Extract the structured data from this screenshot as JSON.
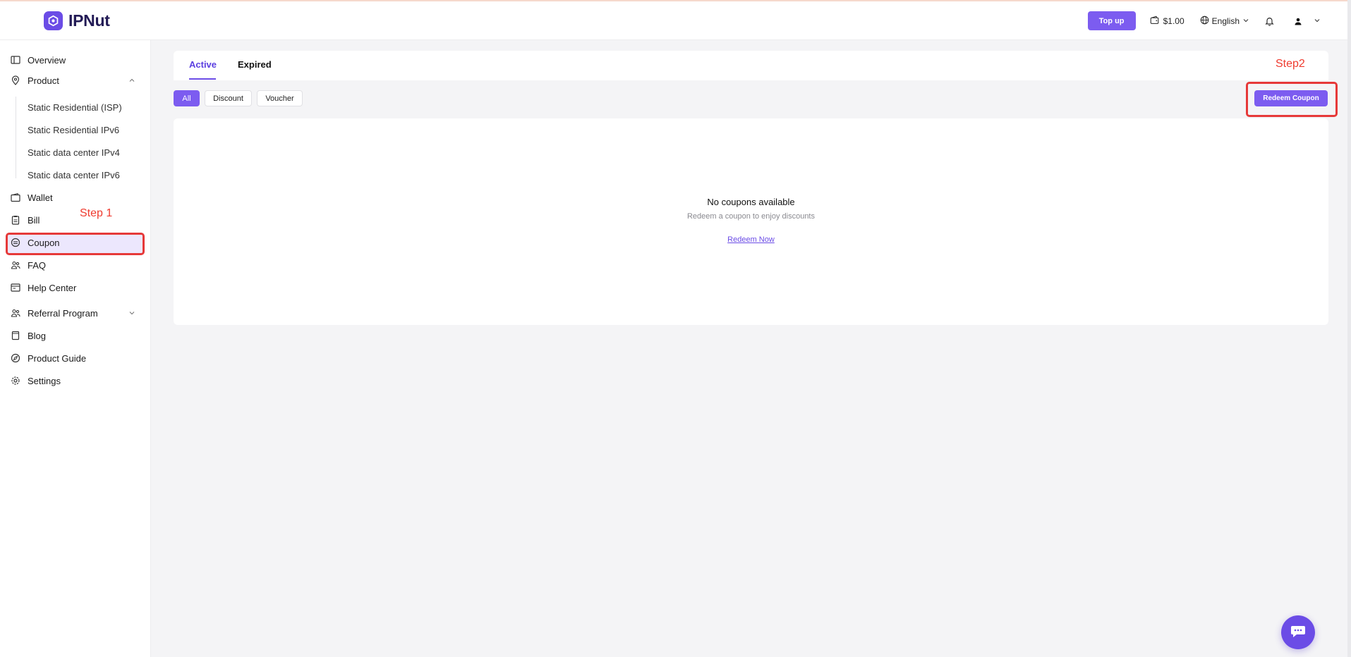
{
  "brand": {
    "name": "IPNut"
  },
  "header": {
    "topup_label": "Top up",
    "balance": "$1.00",
    "language": "English"
  },
  "sidebar": {
    "items": [
      {
        "label": "Overview",
        "icon": "panel-icon"
      },
      {
        "label": "Product",
        "icon": "location-pin-icon"
      },
      {
        "label": "Wallet",
        "icon": "wallet-icon"
      },
      {
        "label": "Bill",
        "icon": "clipboard-icon"
      },
      {
        "label": "Coupon",
        "icon": "coupon-icon"
      },
      {
        "label": "FAQ",
        "icon": "people-icon"
      },
      {
        "label": "Help Center",
        "icon": "browser-icon"
      },
      {
        "label": "Referral Program",
        "icon": "people-icon"
      },
      {
        "label": "Blog",
        "icon": "book-icon"
      },
      {
        "label": "Product Guide",
        "icon": "compass-icon"
      },
      {
        "label": "Settings",
        "icon": "gear-icon"
      }
    ],
    "product_subitems": [
      "Static Residential (ISP)",
      "Static Residential IPv6",
      "Static data center IPv4",
      "Static data center IPv6"
    ],
    "active_item": "Coupon"
  },
  "annotations": {
    "step1": "Step 1",
    "step2": "Step2"
  },
  "tabs": [
    "Active",
    "Expired"
  ],
  "active_tab": "Active",
  "filters": [
    "All",
    "Discount",
    "Voucher"
  ],
  "active_filter": "All",
  "redeem_button": "Redeem Coupon",
  "empty_state": {
    "title": "No coupons available",
    "subtitle": "Redeem a coupon to enjoy discounts",
    "link": "Redeem Now"
  },
  "colors": {
    "accent": "#7c5cf0",
    "highlight": "#e63939",
    "active_bg": "#ece7fd"
  }
}
